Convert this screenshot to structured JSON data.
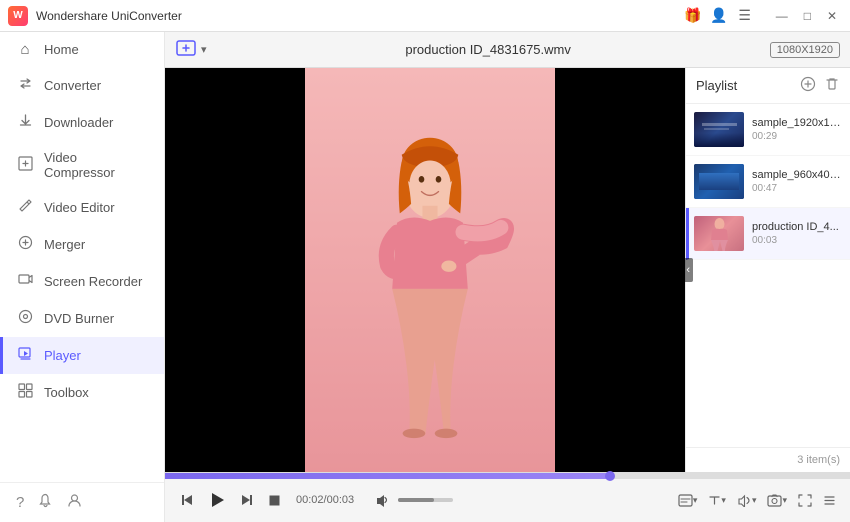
{
  "titleBar": {
    "appName": "Wondershare UniConverter",
    "windowControls": [
      "minimize",
      "maximize",
      "close"
    ]
  },
  "sidebar": {
    "items": [
      {
        "id": "home",
        "label": "Home",
        "icon": "⌂"
      },
      {
        "id": "converter",
        "label": "Converter",
        "icon": "↻"
      },
      {
        "id": "downloader",
        "label": "Downloader",
        "icon": "↓"
      },
      {
        "id": "video-compressor",
        "label": "Video Compressor",
        "icon": "⊞"
      },
      {
        "id": "video-editor",
        "label": "Video Editor",
        "icon": "✂"
      },
      {
        "id": "merger",
        "label": "Merger",
        "icon": "⊕"
      },
      {
        "id": "screen-recorder",
        "label": "Screen Recorder",
        "icon": "▣"
      },
      {
        "id": "dvd-burner",
        "label": "DVD Burner",
        "icon": "⊙"
      },
      {
        "id": "player",
        "label": "Player",
        "icon": "▶",
        "active": true
      },
      {
        "id": "toolbox",
        "label": "Toolbox",
        "icon": "⊞"
      }
    ],
    "footer": {
      "help": "?",
      "bell": "🔔",
      "refresh": "↺"
    }
  },
  "player": {
    "filename": "production ID_4831675.wmv",
    "resolution": "1080X1920",
    "currentTime": "00:02/00:03",
    "playlist": {
      "title": "Playlist",
      "items": [
        {
          "name": "sample_1920x10...",
          "duration": "00:29",
          "type": "ocean"
        },
        {
          "name": "sample_960x400...",
          "duration": "00:47",
          "type": "blue"
        },
        {
          "name": "production ID_4...",
          "duration": "00:03",
          "type": "pink",
          "active": true
        }
      ],
      "count": "3 item(s)"
    }
  }
}
